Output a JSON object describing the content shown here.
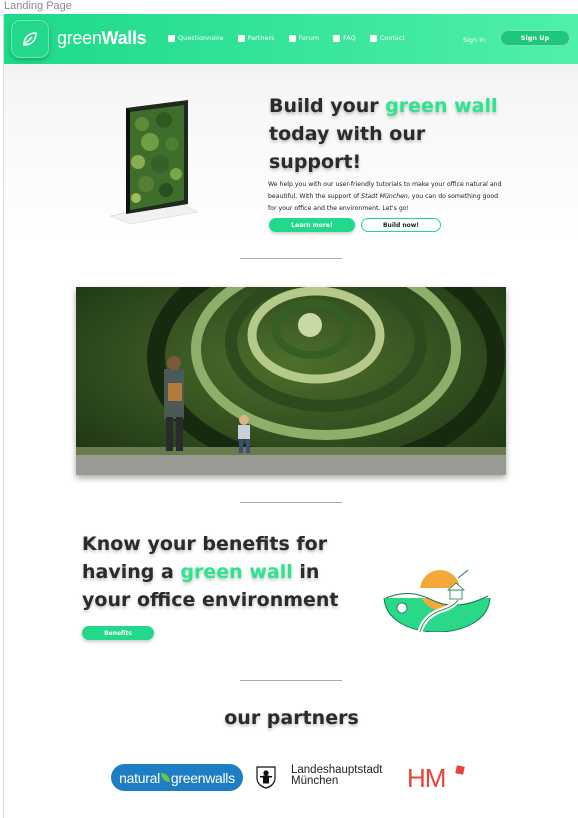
{
  "frame_label": "Landing Page",
  "header": {
    "brand_light": "green",
    "brand_bold": "Walls",
    "nav": [
      {
        "label": "Questionnaire",
        "icon": "check-icon"
      },
      {
        "label": "Partners",
        "icon": "briefcase-icon"
      },
      {
        "label": "Forum",
        "icon": "chat-icon"
      },
      {
        "label": "FAQ",
        "icon": "question-icon"
      },
      {
        "label": "Contact",
        "icon": "mail-icon"
      }
    ],
    "signin": "Sign in",
    "signup": "Sign Up"
  },
  "hero": {
    "title_1": "Build your ",
    "title_accent": "green wall",
    "title_2": "today with our support!",
    "text_1": "We help you with our user-friendly tutorials to make your office natural and beautiful. With the support of ",
    "text_em": "Stadt München",
    "text_2": ", you can do something good for your office and the environment. Let's go!",
    "btn_learn": "Learn more!",
    "btn_build": "Build now!"
  },
  "benefits": {
    "title_1": "Know your benefits for having a ",
    "title_accent": "green wall",
    "title_2": " in your office environment",
    "button": "Benefits"
  },
  "partners": {
    "title": "our partners",
    "natural_1": "natural",
    "natural_2": "greenwalls",
    "munich_1": "Landeshauptstadt",
    "munich_2": "München",
    "hm": "HM"
  },
  "colors": {
    "accent": "#2ee58f",
    "header": "#1dd98a",
    "hm_red": "#e8423a",
    "natural_blue": "#1f7ec3"
  }
}
